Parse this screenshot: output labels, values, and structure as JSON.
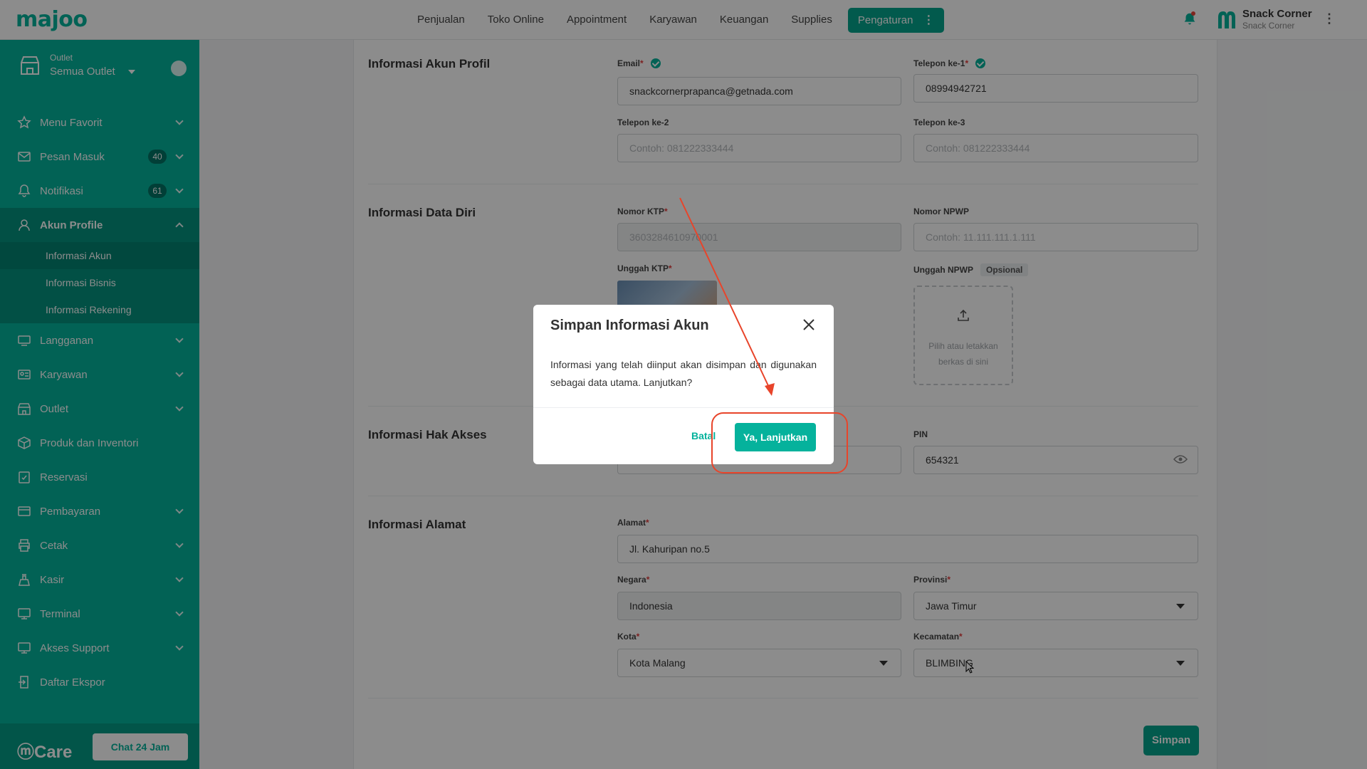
{
  "brand": {
    "logo": "majoo",
    "accent": "#05b29c"
  },
  "topnav": {
    "items": [
      "Penjualan",
      "Toko Online",
      "Appointment",
      "Karyawan",
      "Keuangan",
      "Supplies"
    ],
    "active": "Pengaturan",
    "store_name": "Snack Corner",
    "store_sub": "Snack Corner"
  },
  "sidebar": {
    "outlet_label": "Outlet",
    "outlet_value": "Semua Outlet",
    "items": [
      {
        "label": "Menu Favorit",
        "icon": "star-icon"
      },
      {
        "label": "Pesan Masuk",
        "icon": "mail-icon",
        "badge": "40"
      },
      {
        "label": "Notifikasi",
        "icon": "bell-icon",
        "badge": "61"
      },
      {
        "label": "Akun Profile",
        "icon": "user-icon"
      },
      {
        "label": "Langganan",
        "icon": "subscription-icon"
      },
      {
        "label": "Karyawan",
        "icon": "employee-icon"
      },
      {
        "label": "Outlet",
        "icon": "store-icon"
      },
      {
        "label": "Produk dan Inventori",
        "icon": "box-icon"
      },
      {
        "label": "Reservasi",
        "icon": "calendar-check-icon"
      },
      {
        "label": "Pembayaran",
        "icon": "payment-icon"
      },
      {
        "label": "Cetak",
        "icon": "printer-icon"
      },
      {
        "label": "Kasir",
        "icon": "cashier-icon"
      },
      {
        "label": "Terminal",
        "icon": "terminal-icon"
      },
      {
        "label": "Akses Support",
        "icon": "support-icon"
      },
      {
        "label": "Daftar Ekspor",
        "icon": "export-icon"
      }
    ],
    "submenu": [
      "Informasi Akun",
      "Informasi Bisnis",
      "Informasi Rekening"
    ],
    "care_logo": "Care",
    "chat_button": "Chat 24 Jam"
  },
  "form": {
    "akun_profil": {
      "title": "Informasi Akun Profil",
      "email_label": "Email",
      "email_value": "snackcornerprapanca@getnada.com",
      "phone1_label": "Telepon ke-1",
      "phone1_value": "08994942721",
      "phone2_label": "Telepon ke-2",
      "phone2_placeholder": "Contoh: 081222333444",
      "phone3_label": "Telepon ke-3",
      "phone3_placeholder": "Contoh: 081222333444"
    },
    "data_diri": {
      "title": "Informasi Data Diri",
      "ktp_label": "Nomor KTP",
      "ktp_value": "3603284610970001",
      "npwp_label": "Nomor NPWP",
      "npwp_placeholder": "Contoh: 11.111.111.1.111",
      "upload_ktp_label": "Unggah KTP",
      "upload_npwp_label": "Unggah NPWP",
      "opsional": "Opsional",
      "upload_hint_1": "Pilih atau letakkan",
      "upload_hint_2": "berkas di sini"
    },
    "hak_akses": {
      "title": "Informasi Hak Akses",
      "pin_label": "PIN",
      "pin_value": "654321"
    },
    "alamat": {
      "title": "Informasi Alamat",
      "alamat_label": "Alamat",
      "alamat_value": "Jl. Kahuripan no.5",
      "negara_label": "Negara",
      "negara_value": "Indonesia",
      "provinsi_label": "Provinsi",
      "provinsi_value": "Jawa Timur",
      "kota_label": "Kota",
      "kota_value": "Kota Malang",
      "kecamatan_label": "Kecamatan",
      "kecamatan_value": "BLIMBING"
    },
    "save_button": "Simpan"
  },
  "modal": {
    "title": "Simpan Informasi Akun",
    "body": "Informasi yang telah diinput akan disimpan dan digunakan sebagai data utama. Lanjutkan?",
    "cancel": "Batal",
    "confirm": "Ya, Lanjutkan"
  },
  "annotation_color": "#e8442a"
}
